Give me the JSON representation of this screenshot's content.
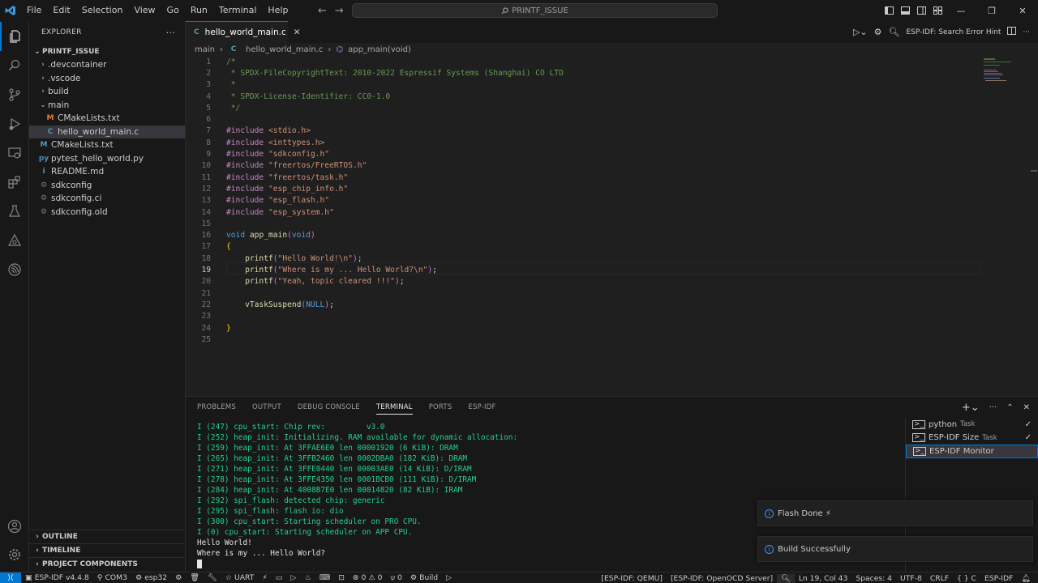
{
  "titlebar": {
    "menu": [
      "File",
      "Edit",
      "Selection",
      "View",
      "Go",
      "Run",
      "Terminal",
      "Help"
    ],
    "search_text": "PRINTF_ISSUE"
  },
  "explorer": {
    "title": "EXPLORER",
    "project": "PRINTF_ISSUE",
    "tree": [
      {
        "label": ".devcontainer",
        "type": "folder",
        "indent": 1,
        "expanded": false
      },
      {
        "label": ".vscode",
        "type": "folder",
        "indent": 1,
        "expanded": false
      },
      {
        "label": "build",
        "type": "folder",
        "indent": 1,
        "expanded": false
      },
      {
        "label": "main",
        "type": "folder",
        "indent": 1,
        "expanded": true
      },
      {
        "label": "CMakeLists.txt",
        "type": "cmake-main",
        "indent": 2,
        "icon": "M"
      },
      {
        "label": "hello_world_main.c",
        "type": "c",
        "indent": 2,
        "icon": "C",
        "selected": true
      },
      {
        "label": "CMakeLists.txt",
        "type": "cmake",
        "indent": 1,
        "icon": "M"
      },
      {
        "label": "pytest_hello_world.py",
        "type": "py",
        "indent": 1,
        "icon": "py"
      },
      {
        "label": "README.md",
        "type": "md",
        "indent": 1,
        "icon": "i"
      },
      {
        "label": "sdkconfig",
        "type": "gear",
        "indent": 1,
        "icon": "⚙"
      },
      {
        "label": "sdkconfig.ci",
        "type": "gear",
        "indent": 1,
        "icon": "⚙"
      },
      {
        "label": "sdkconfig.old",
        "type": "gear",
        "indent": 1,
        "icon": "⚙"
      }
    ],
    "sections": [
      "OUTLINE",
      "TIMELINE",
      "PROJECT COMPONENTS"
    ]
  },
  "editor": {
    "tab": "hello_world_main.c",
    "breadcrumb": [
      "main",
      "hello_world_main.c",
      "app_main(void)"
    ],
    "search_hint": "ESP-IDF: Search Error Hint",
    "current_line": 19
  },
  "code": [
    "/*",
    " * SPDX-FileCopyrightText: 2010-2022 Espressif Systems (Shanghai) CO LTD",
    " *",
    " * SPDX-License-Identifier: CC0-1.0",
    " */",
    "",
    "#include <stdio.h>",
    "#include <inttypes.h>",
    "#include \"sdkconfig.h\"",
    "#include \"freertos/FreeRTOS.h\"",
    "#include \"freertos/task.h\"",
    "#include \"esp_chip_info.h\"",
    "#include \"esp_flash.h\"",
    "#include \"esp_system.h\"",
    "",
    "void app_main(void)",
    "{",
    "    printf(\"Hello World!\\n\");",
    "    printf(\"Where is my ... Hello World?\\n\");",
    "    printf(\"Yeah, topic cleared !!!\");",
    "",
    "    vTaskSuspend(NULL);",
    "",
    "}",
    ""
  ],
  "panel": {
    "tabs": [
      "PROBLEMS",
      "OUTPUT",
      "DEBUG CONSOLE",
      "TERMINAL",
      "PORTS",
      "ESP-IDF"
    ],
    "active_tab": "TERMINAL",
    "terminal_lines": [
      "I (247) cpu_start: Chip rev:         v3.0",
      "I (252) heap_init: Initializing. RAM available for dynamic allocation:",
      "I (259) heap_init: At 3FFAE6E0 len 00001920 (6 KiB): DRAM",
      "I (265) heap_init: At 3FFB2460 len 0002DBA0 (182 KiB): DRAM",
      "I (271) heap_init: At 3FFE0440 len 00003AE0 (14 KiB): D/IRAM",
      "I (278) heap_init: At 3FFE4350 len 0001BCB0 (111 KiB): D/IRAM",
      "I (284) heap_init: At 4008B7E0 len 00014820 (82 KiB): IRAM",
      "I (292) spi_flash: detected chip: generic",
      "I (295) spi_flash: flash io: dio",
      "I (300) cpu_start: Starting scheduler on PRO CPU.",
      "I (0) cpu_start: Starting scheduler on APP CPU."
    ],
    "output_lines": [
      "Hello World!",
      "Where is my ... Hello World?"
    ],
    "terminals": [
      {
        "name": "python",
        "sub": "Task",
        "check": true
      },
      {
        "name": "ESP-IDF Size",
        "sub": "Task",
        "check": true
      },
      {
        "name": "ESP-IDF Monitor",
        "sub": "",
        "check": false,
        "selected": true
      }
    ]
  },
  "notifications": {
    "flash": "Flash Done ⚡",
    "build": "Build Successfully"
  },
  "statusbar": {
    "idf_version": "ESP-IDF v4.4.8",
    "port": "COM3",
    "target": "esp32",
    "uart": "UART",
    "errors": "0",
    "warnings": "0",
    "ports": "0",
    "build": "Build",
    "qemu": "[ESP-IDF: QEMU]",
    "openocd": "[ESP-IDF: OpenOCD Server]",
    "position": "Ln 19, Col 43",
    "spaces": "Spaces: 4",
    "encoding": "UTF-8",
    "eol": "CRLF",
    "language": "{ } C",
    "esp_idf": "ESP-IDF"
  }
}
